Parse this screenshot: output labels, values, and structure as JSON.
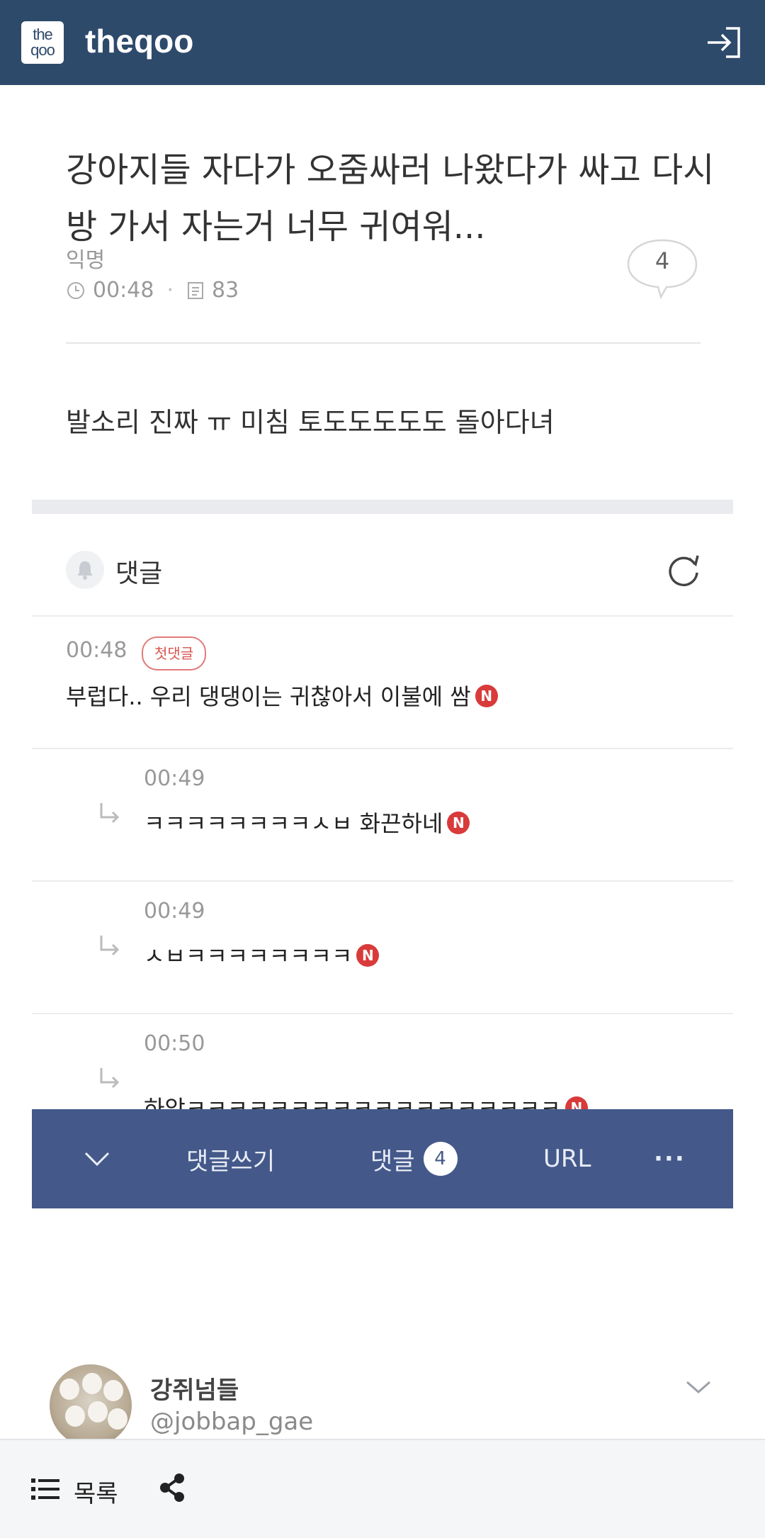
{
  "header": {
    "logo_top": "the",
    "logo_bottom": "qoo",
    "site_name": "theqoo",
    "login_icon": "login-icon"
  },
  "post": {
    "title": "강아지들 자다가 오줌싸러 나왔다가 싸고 다시 방 가서 자는거 너무 귀여워...",
    "author": "익명",
    "time": "00:48",
    "views": "83",
    "comment_count": "4",
    "body": "발소리 진짜 ㅠ 미침 토도도도도도 돌아다녀"
  },
  "comments_section": {
    "label": "댓글",
    "bell_icon": "bell-icon",
    "refresh_icon": "refresh-icon",
    "first_badge": "첫댓글",
    "new_badge": "N",
    "items": [
      {
        "time": "00:48",
        "text": "부럽다.. 우리 댕댕이는 귀찮아서 이불에 쌈",
        "reply": false
      },
      {
        "time": "00:49",
        "text": "ㅋㅋㅋㅋㅋㅋㅋㅋㅅㅂ 화끈하네",
        "reply": true
      },
      {
        "time": "00:49",
        "text": "ㅅㅂㅋㅋㅋㅋㅋㅋㅋㅋ",
        "reply": true
      },
      {
        "time": "00:50",
        "text": "하앜ㅋㅋㅋㅋㅋㅋㅋㅋㅋㅋㅋㅋㅋㅋㅋㅋㅋㅋ",
        "reply": true
      }
    ]
  },
  "action_bar": {
    "collapse_icon": "chevron-down-icon",
    "write_label": "댓글쓰기",
    "comments_label": "댓글",
    "comments_count": "4",
    "url_label": "URL",
    "more_label": "···"
  },
  "twitter_card": {
    "name": "강쥐넘들",
    "handle": "@jobbap_gae"
  },
  "bottom_bar": {
    "list_label": "목록",
    "share_icon": "share-icon"
  },
  "colors": {
    "header_bg": "#2e4a6b",
    "action_bar_bg": "#44598a",
    "new_badge": "#d93a3a",
    "first_badge_border": "#e27a7a"
  }
}
